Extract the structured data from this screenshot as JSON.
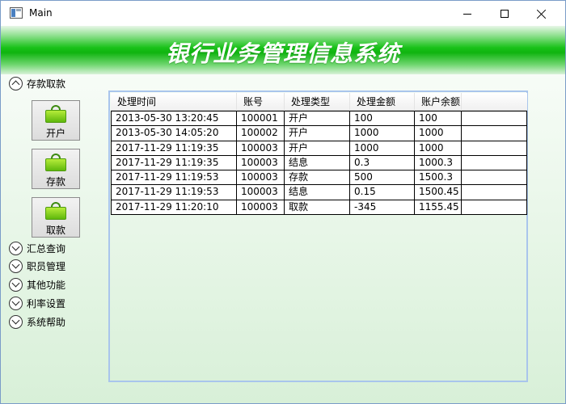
{
  "window": {
    "title": "Main"
  },
  "banner": {
    "title": "银行业务管理信息系统"
  },
  "sidebar": {
    "sections": [
      {
        "label": "存款取款",
        "expanded": true
      },
      {
        "label": "汇总查询",
        "expanded": false
      },
      {
        "label": "职员管理",
        "expanded": false
      },
      {
        "label": "其他功能",
        "expanded": false
      },
      {
        "label": "利率设置",
        "expanded": false
      },
      {
        "label": "系统帮助",
        "expanded": false
      }
    ],
    "actions": [
      {
        "label": "开户",
        "icon": "shopping-bag-icon"
      },
      {
        "label": "存款",
        "icon": "shopping-bag-icon"
      },
      {
        "label": "取款",
        "icon": "shopping-bag-icon"
      }
    ]
  },
  "table": {
    "columns": [
      "处理时间",
      "账号",
      "处理类型",
      "处理金额",
      "账户余额"
    ],
    "rows": [
      [
        "2013-05-30 13:20:45",
        "100001",
        "开户",
        "100",
        "100"
      ],
      [
        "2013-05-30 14:05:20",
        "100002",
        "开户",
        "1000",
        "1000"
      ],
      [
        "2017-11-29 11:19:35",
        "100003",
        "开户",
        "1000",
        "1000"
      ],
      [
        "2017-11-29 11:19:35",
        "100003",
        "结息",
        "0.3",
        "1000.3"
      ],
      [
        "2017-11-29 11:19:53",
        "100003",
        "存款",
        "500",
        "1500.3"
      ],
      [
        "2017-11-29 11:19:53",
        "100003",
        "结息",
        "0.15",
        "1500.45"
      ],
      [
        "2017-11-29 11:20:10",
        "100003",
        "取款",
        "-345",
        "1155.45"
      ]
    ]
  },
  "colors": {
    "banner_green": "#0fb40f",
    "panel_border": "#a9c5ec",
    "content_bg": "#eaf7ea"
  }
}
